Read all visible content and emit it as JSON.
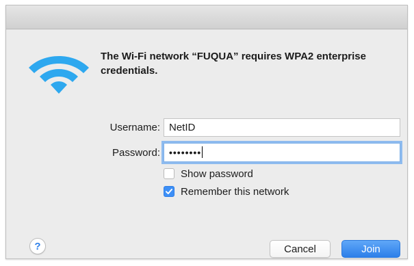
{
  "dialog": {
    "message": "The Wi-Fi network “FUQUA” requires WPA2 enterprise credentials.",
    "icon": "wifi-icon",
    "accent_color": "#2d7fe9"
  },
  "form": {
    "username_label": "Username:",
    "username_value": "NetID",
    "password_label": "Password:",
    "password_masked": "••••••••"
  },
  "options": {
    "show_password_label": "Show password",
    "show_password_checked": false,
    "remember_label": "Remember this network",
    "remember_checked": true
  },
  "buttons": {
    "help_label": "?",
    "cancel_label": "Cancel",
    "join_label": "Join"
  }
}
